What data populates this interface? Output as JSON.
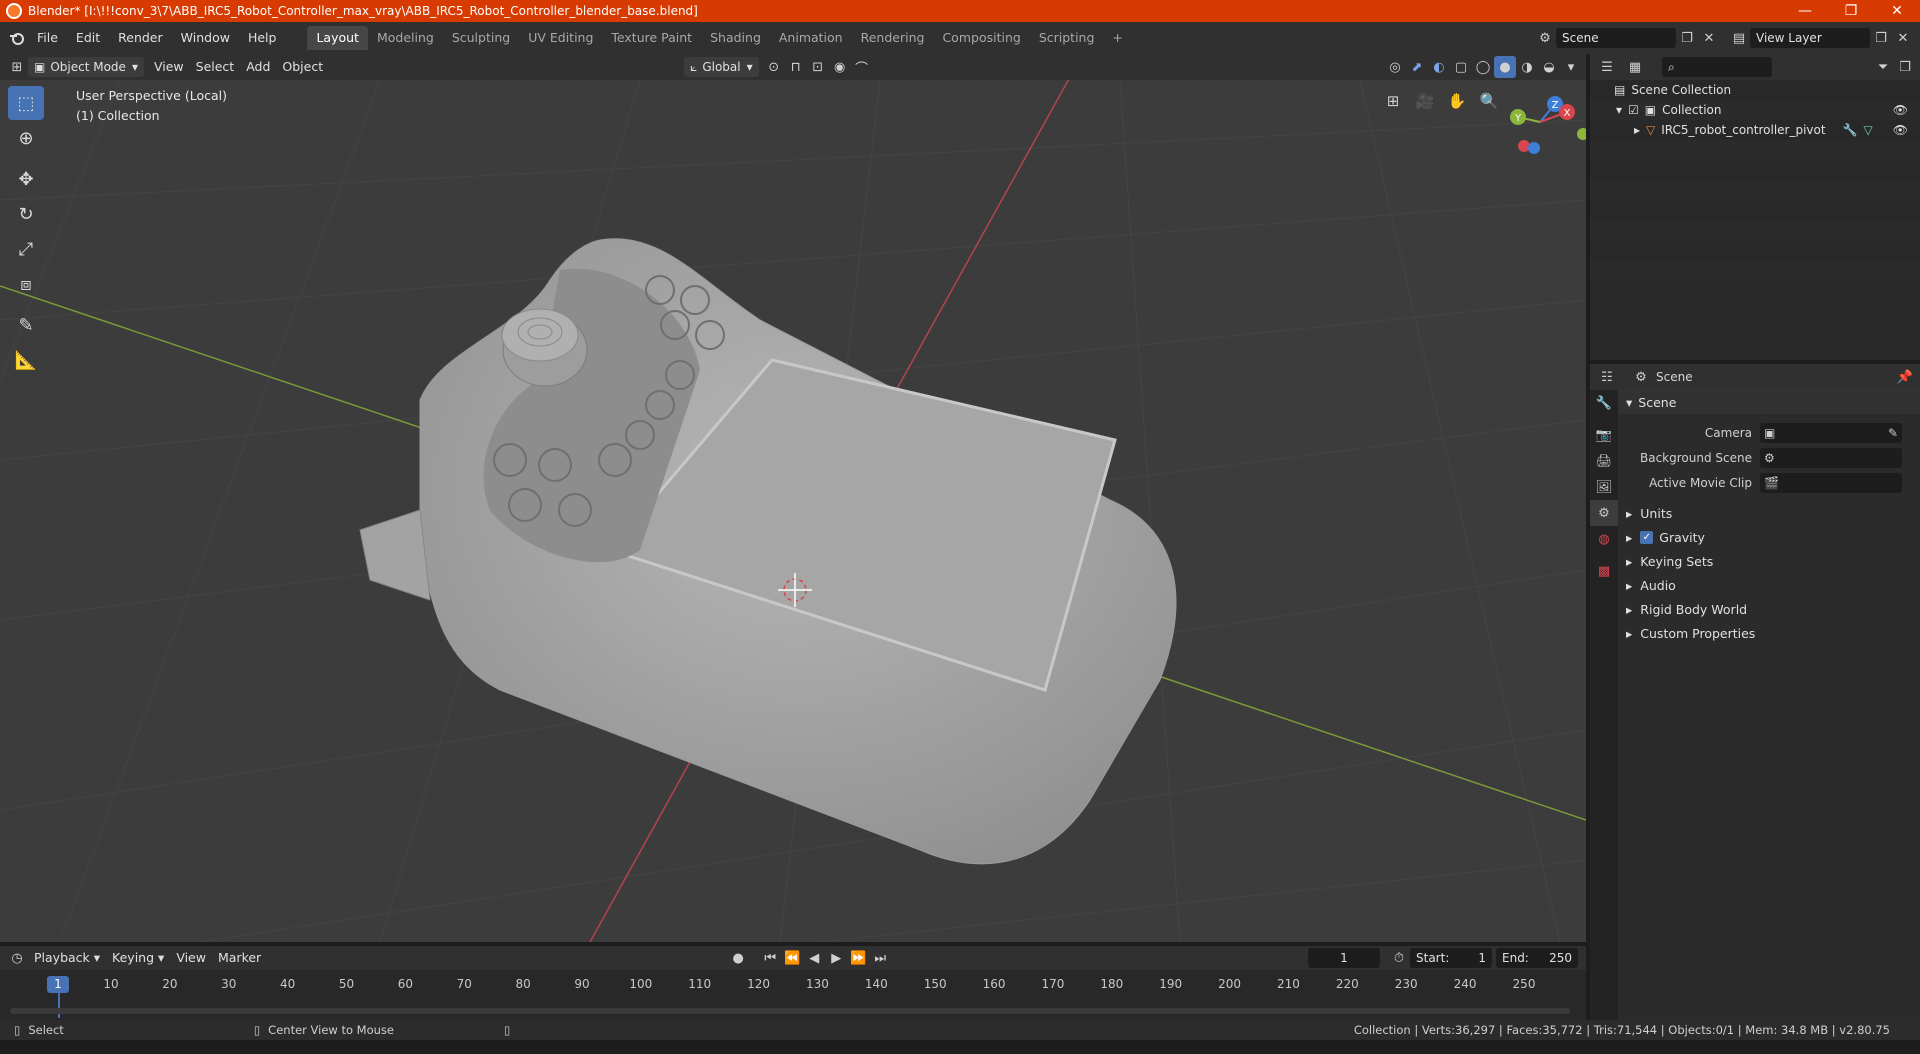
{
  "window": {
    "title": "Blender* [I:\\!!!conv_3\\7\\ABB_IRC5_Robot_Controller_max_vray\\ABB_IRC5_Robot_Controller_blender_base.blend]",
    "minimize": "—",
    "maximize": "❐",
    "close": "✕"
  },
  "menu": {
    "items": [
      "File",
      "Edit",
      "Render",
      "Window",
      "Help"
    ]
  },
  "workspaces": {
    "tabs": [
      "Layout",
      "Modeling",
      "Sculpting",
      "UV Editing",
      "Texture Paint",
      "Shading",
      "Animation",
      "Rendering",
      "Compositing",
      "Scripting"
    ],
    "active": "Layout",
    "add": "+"
  },
  "scene_selector": {
    "value": "Scene"
  },
  "view_layer": {
    "value": "View Layer"
  },
  "viewport_header": {
    "mode": "Object Mode",
    "menus": [
      "View",
      "Select",
      "Add",
      "Object"
    ],
    "transform": "Global"
  },
  "viewport": {
    "perspective": "User Perspective (Local)",
    "collection": "(1) Collection",
    "gizmo": {
      "x": "X",
      "y": "Y",
      "z": "Z"
    }
  },
  "outliner": {
    "scene_collection": "Scene Collection",
    "collection": "Collection",
    "object": "IRC5_robot_controller_pivot"
  },
  "properties": {
    "context": "Scene",
    "panel": "Scene",
    "rows": [
      {
        "label": "Camera"
      },
      {
        "label": "Background Scene"
      },
      {
        "label": "Active Movie Clip"
      }
    ],
    "subpanels": [
      "Units",
      "Gravity",
      "Keying Sets",
      "Audio",
      "Rigid Body World",
      "Custom Properties"
    ]
  },
  "timeline": {
    "menus": [
      "Playback",
      "Keying",
      "View",
      "Marker"
    ],
    "current_frame": "1",
    "start_label": "Start:",
    "start": "1",
    "end_label": "End:",
    "end": "250",
    "ticks": [
      "1",
      "10",
      "20",
      "30",
      "40",
      "50",
      "60",
      "70",
      "80",
      "90",
      "100",
      "110",
      "120",
      "130",
      "140",
      "150",
      "160",
      "170",
      "180",
      "190",
      "200",
      "210",
      "220",
      "230",
      "240",
      "250"
    ]
  },
  "status": {
    "select": "Select",
    "center": "Center View to Mouse",
    "stats": "Collection | Verts:36,297 | Faces:35,772 | Tris:71,544 | Objects:0/1 | Mem: 34.8 MB | v2.80.75"
  },
  "colors": {
    "titlebar": "#d83b01",
    "accent": "#4772b3",
    "x_axis": "#d8454f",
    "y_axis": "#8bb63c",
    "z_axis": "#3f7fd9"
  }
}
